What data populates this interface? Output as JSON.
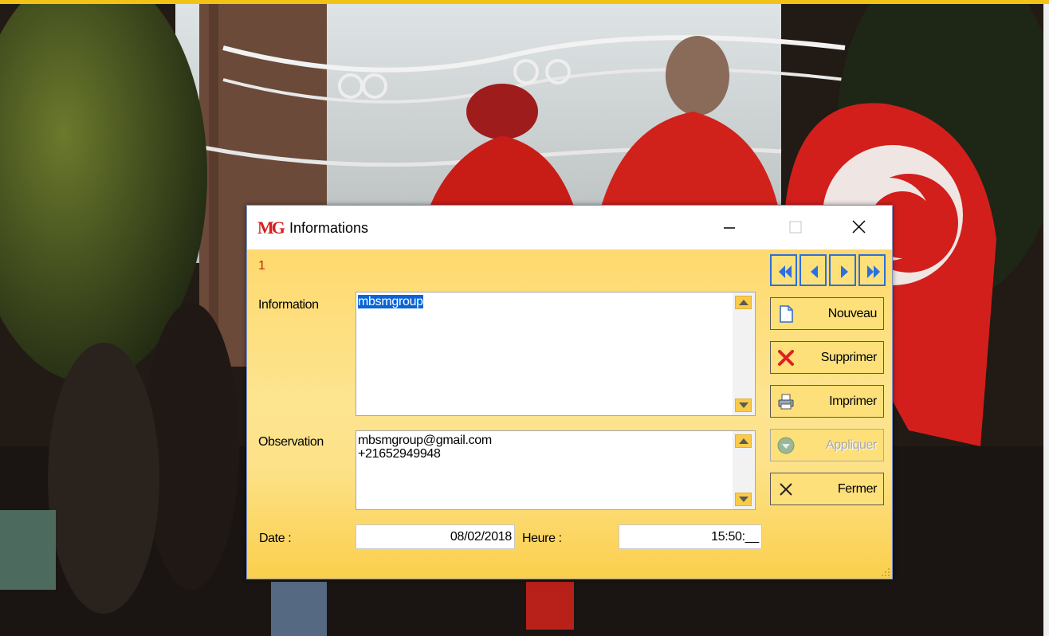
{
  "window": {
    "title": "Informations",
    "logo_text": "MG"
  },
  "record": {
    "number": "1"
  },
  "form": {
    "information_label": "Information",
    "information_value": "mbsmgroup",
    "observation_label": "Observation",
    "observation_value": "mbsmgroup@gmail.com\n+21652949948",
    "date_label": "Date :",
    "date_value": "08/02/2018",
    "heure_label": "Heure :",
    "heure_value": "15:50:__"
  },
  "navigation": {
    "icons": [
      "first-record-icon",
      "previous-record-icon",
      "next-record-icon",
      "last-record-icon"
    ]
  },
  "actions": {
    "nouveau": "Nouveau",
    "supprimer": "Supprimer",
    "imprimer": "Imprimer",
    "appliquer": "Appliquer",
    "fermer": "Fermer"
  },
  "colors": {
    "accent_yellow": "#fde07a",
    "nav_border": "#2b6fe0",
    "record_number": "#cc2200",
    "selection": "#0a64d8",
    "delete_red": "#e02020"
  }
}
